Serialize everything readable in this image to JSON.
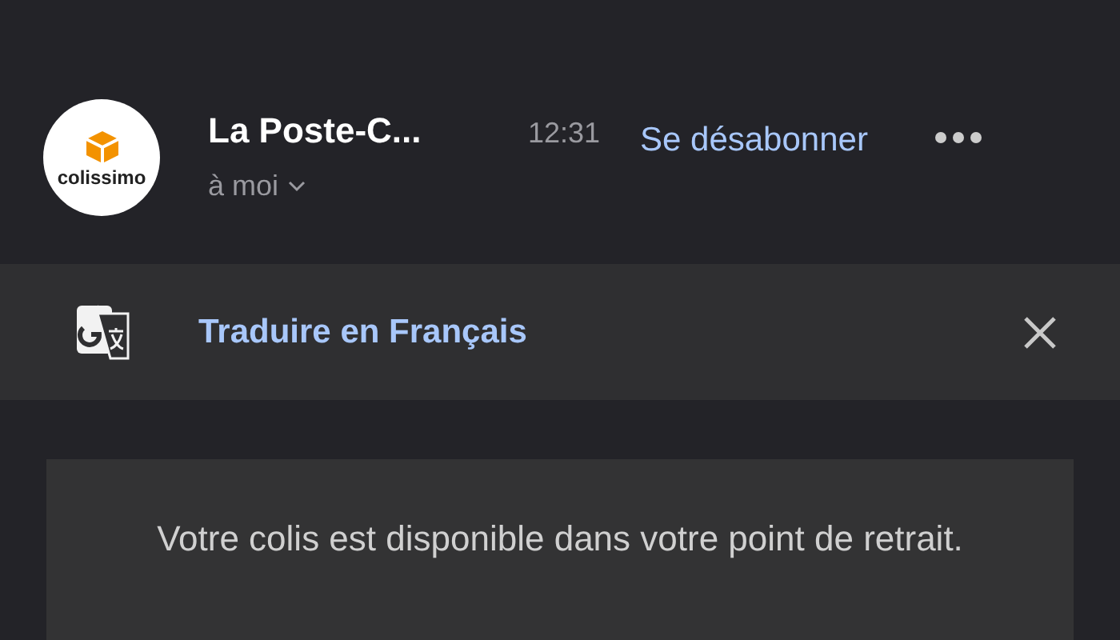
{
  "header": {
    "sender": "La Poste-C...",
    "time": "12:31",
    "recipient": "à moi",
    "unsubscribe": "Se désabonner",
    "avatar_text": "colissimo"
  },
  "translate_bar": {
    "label": "Traduire en Français"
  },
  "message": {
    "text": "Votre colis est disponible dans votre point de retrait."
  }
}
